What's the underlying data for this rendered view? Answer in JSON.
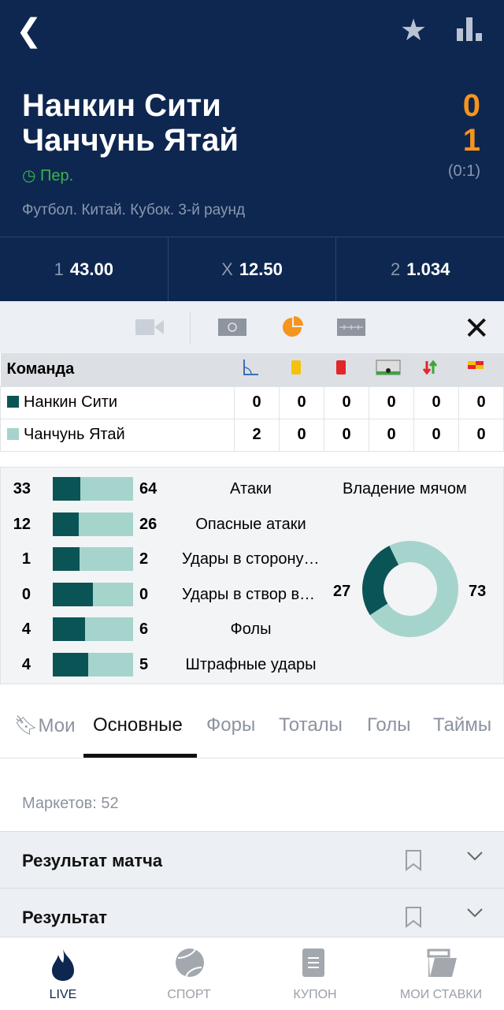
{
  "header": {
    "back_icon": "chevron-left-icon",
    "favorite_icon": "star-icon",
    "stats_icon": "bar-chart-icon",
    "team1": "Нанкин Сити",
    "team2": "Чанчунь Ятай",
    "score1": "0",
    "score2": "1",
    "halftime": "(0:1)",
    "period": "Пер.",
    "league": "Футбол. Китай. Кубок. 3-й раунд"
  },
  "odds": [
    {
      "key": "1",
      "value": "43.00"
    },
    {
      "key": "X",
      "value": "12.50"
    },
    {
      "key": "2",
      "value": "1.034"
    }
  ],
  "colors": {
    "header_bg": "#0e2750",
    "score": "#f7941d",
    "team1": "#0b5456",
    "team2": "#a5d4cc",
    "active_tool": "#f7941d"
  },
  "table": {
    "header": "Команда",
    "columns": [
      "corners",
      "yellow-cards",
      "red-cards",
      "goals",
      "substitutions",
      "penalties"
    ],
    "rows": [
      {
        "team": "Нанкин Сити",
        "values": [
          "0",
          "0",
          "0",
          "0",
          "0",
          "0"
        ]
      },
      {
        "team": "Чанчунь Ятай",
        "values": [
          "2",
          "0",
          "0",
          "0",
          "0",
          "0"
        ]
      }
    ]
  },
  "stats": [
    {
      "label": "Атаки",
      "a": "33",
      "b": "64",
      "share": 0.34
    },
    {
      "label": "Опасные атаки",
      "a": "12",
      "b": "26",
      "share": 0.32
    },
    {
      "label": "Удары в сторону ворот",
      "a": "1",
      "b": "2",
      "share": 0.33
    },
    {
      "label": "Удары в створ ворот",
      "a": "0",
      "b": "0",
      "share": 0.5
    },
    {
      "label": "Фолы",
      "a": "4",
      "b": "6",
      "share": 0.4
    },
    {
      "label": "Штрафные удары",
      "a": "4",
      "b": "5",
      "share": 0.44
    }
  ],
  "possession": {
    "label": "Владение мячом",
    "a": "27",
    "b": "73",
    "a_value": 27,
    "b_value": 73
  },
  "tabs": [
    "Мои",
    "Основные",
    "Форы",
    "Тоталы",
    "Голы",
    "Таймы"
  ],
  "markets_count": "Маркетов: 52",
  "markets": [
    "Результат матча",
    "Результат"
  ],
  "nav": [
    "LIVE",
    "СПОРТ",
    "КУПОН",
    "МОИ СТАВКИ"
  ]
}
